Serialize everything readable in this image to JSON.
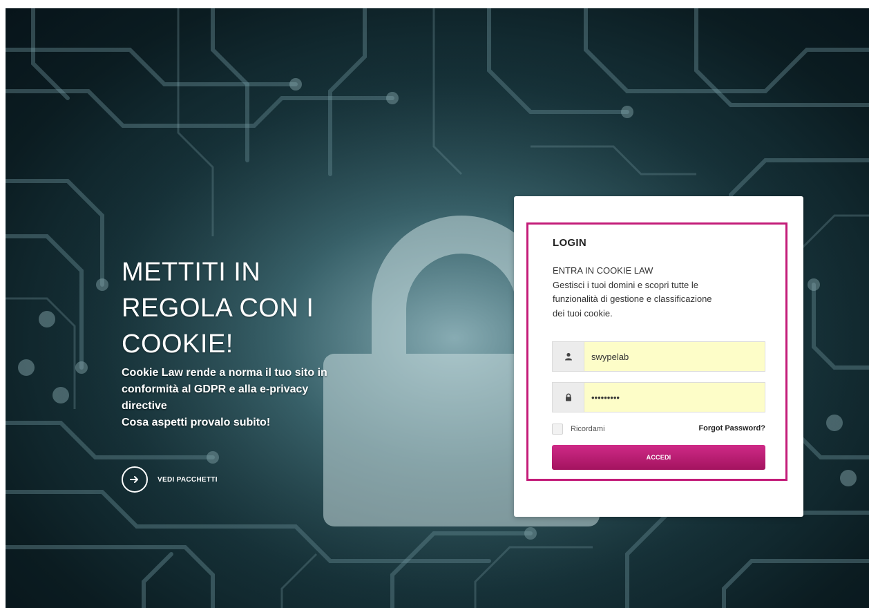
{
  "hero": {
    "title_lines": [
      "METTITI IN",
      "REGOLA CON I",
      "COOKIE!"
    ],
    "description_lines": [
      "Cookie Law rende a norma il tuo sito in",
      "conformità al GDPR e alla e-privacy",
      "directive",
      "Cosa aspetti provalo subito!"
    ],
    "cta_label": "VEDI PACCHETTI",
    "cta_icon": "arrow-right-icon"
  },
  "login": {
    "title": "LOGIN",
    "subtitle": "ENTRA IN COOKIE LAW",
    "description_lines": [
      "Gestisci i tuoi domini e scopri tutte le",
      "funzionalità di gestione e classificazione",
      "dei tuoi cookie."
    ],
    "username": {
      "value": "swypelab",
      "icon": "user-icon"
    },
    "password": {
      "value": "•••••••••",
      "icon": "lock-icon"
    },
    "remember_label": "Ricordami",
    "remember_checked": false,
    "forgot_label": "Forgot Password?",
    "submit_label": "ACCEDI"
  },
  "colors": {
    "accent": "#c31b78",
    "button": "#b81d6f",
    "input_autofill": "#fdfdc8",
    "background_dark": "#0b1c21"
  }
}
